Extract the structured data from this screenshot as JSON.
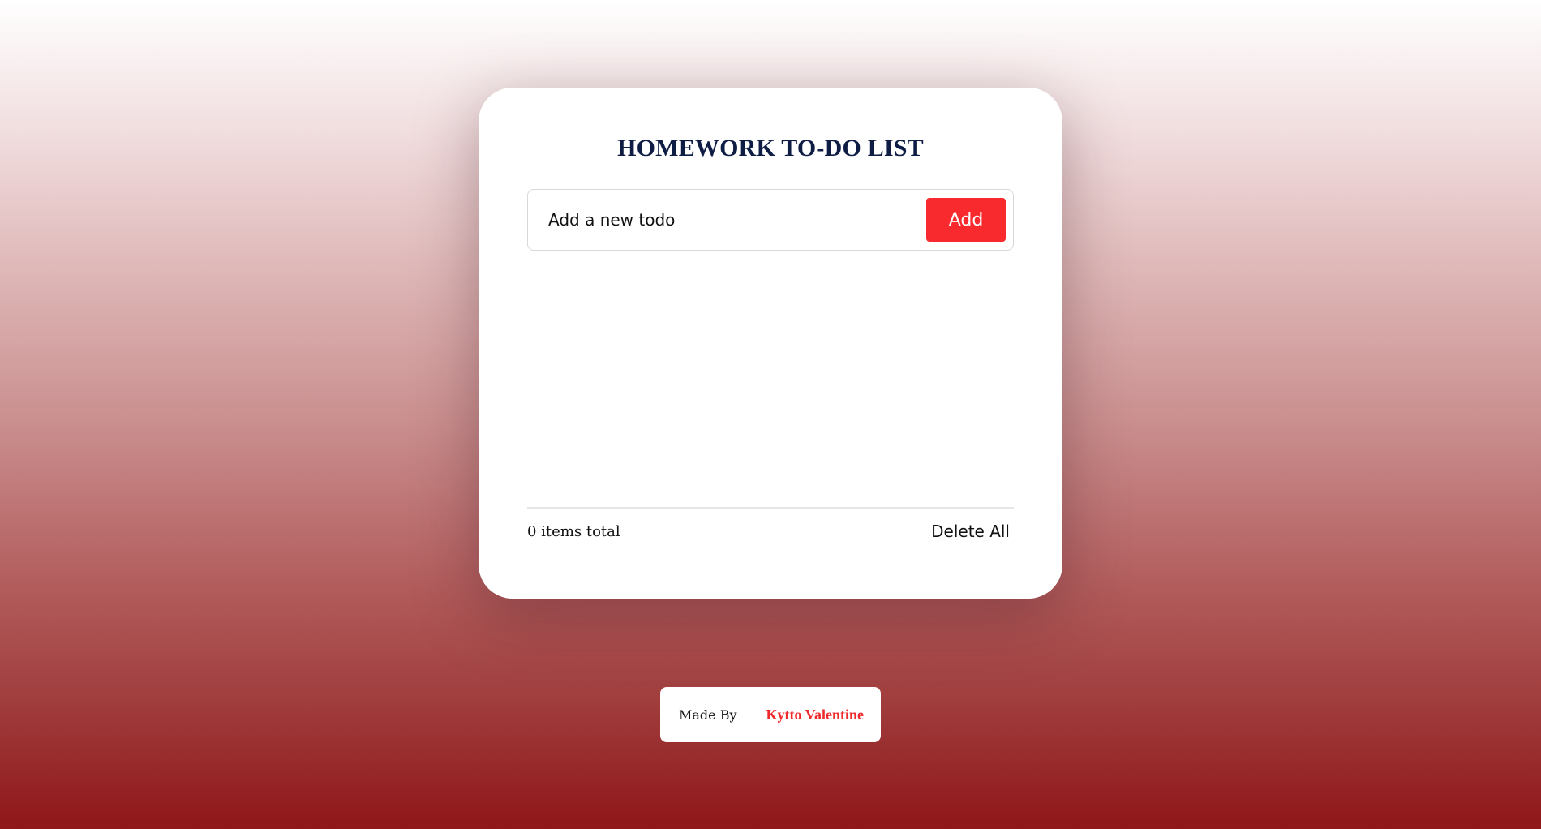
{
  "app": {
    "title": "HOMEWORK TO-DO LIST"
  },
  "form": {
    "input_placeholder": "Add a new todo",
    "input_value": "",
    "add_label": "Add"
  },
  "todos": [],
  "footer_bar": {
    "count_text": "0 items total",
    "delete_all_label": "Delete All"
  },
  "credit": {
    "made_by_label": "Made By",
    "author_name": "Kytto Valentine"
  },
  "colors": {
    "accent": "#f82a2e",
    "title": "#0f1d45",
    "background_bottom": "#8f1619"
  }
}
